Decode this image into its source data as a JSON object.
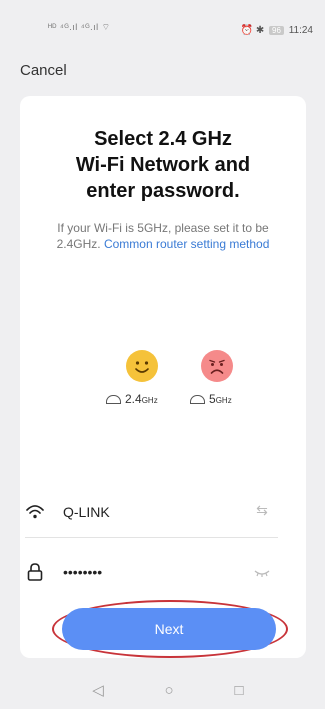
{
  "status_bar": {
    "left_text": "ᴴᴰ ⁴ᴳ.ıl ⁴ᴳ.ıl ⌔",
    "battery": "96",
    "time": "11:24"
  },
  "header": {
    "cancel_label": "Cancel"
  },
  "card": {
    "title_line1": "Select 2.4 GHz",
    "title_line2": "Wi-Fi Network and",
    "title_line3": "enter password.",
    "hint_text": "If your Wi-Fi is 5GHz, please set it to be 2.4GHz.",
    "hint_link": "Common router setting method",
    "band_24_main": "2.4",
    "band_24_unit": "GHz",
    "band_5_main": "5",
    "band_5_unit": "GHz"
  },
  "ssid_field": {
    "value": "Q-LINK",
    "icon": "wifi-icon",
    "action_icon": "switch-icon"
  },
  "password_field": {
    "value": "••••••••",
    "icon": "lock-icon",
    "action_icon": "eye-closed-icon"
  },
  "next_label": "Next",
  "nav": {
    "back": "◁",
    "home": "○",
    "recent": "□"
  },
  "colors": {
    "accent": "#5b8ff5",
    "highlight": "#c8343a",
    "happy": "#f5c23a",
    "sad": "#f58a8a"
  }
}
